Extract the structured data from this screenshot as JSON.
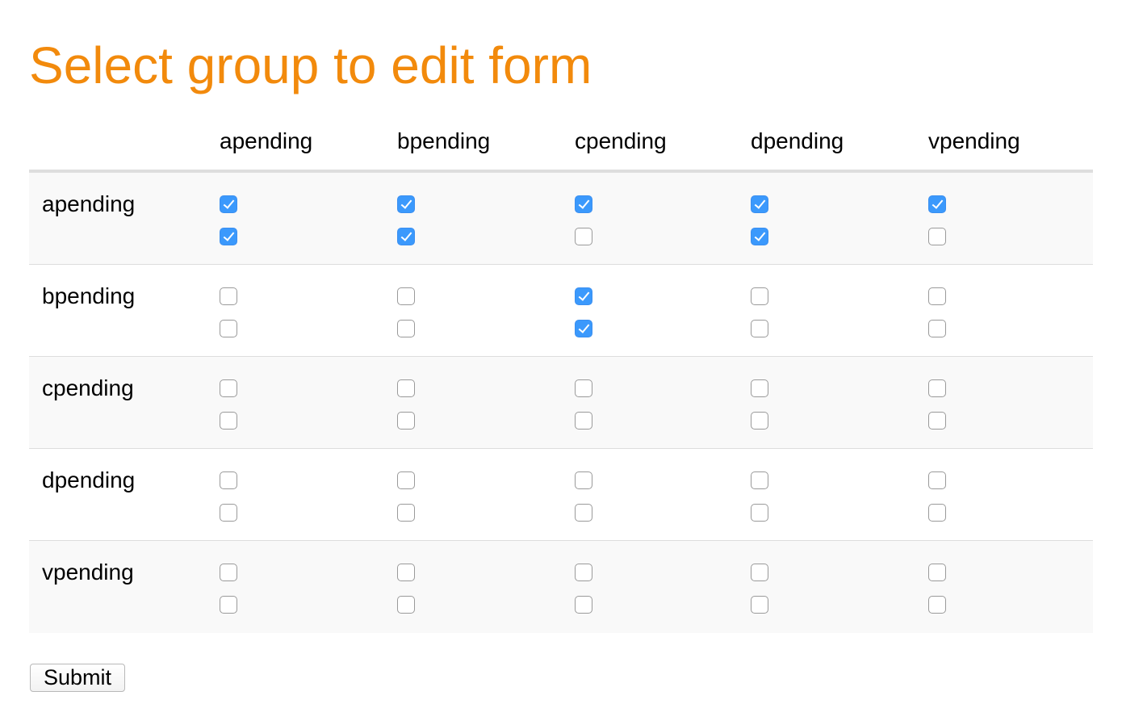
{
  "page": {
    "title": "Select group to edit form",
    "title_color": "#f28a0c",
    "accent_color": "#3b99fc"
  },
  "columns": [
    "apending",
    "bpending",
    "cpending",
    "dpending",
    "vpending"
  ],
  "rows": [
    {
      "label": "apending",
      "checks": [
        [
          true,
          true
        ],
        [
          true,
          true
        ],
        [
          true,
          false
        ],
        [
          true,
          true
        ],
        [
          true,
          false
        ]
      ]
    },
    {
      "label": "bpending",
      "checks": [
        [
          false,
          false
        ],
        [
          false,
          false
        ],
        [
          true,
          true
        ],
        [
          false,
          false
        ],
        [
          false,
          false
        ]
      ]
    },
    {
      "label": "cpending",
      "checks": [
        [
          false,
          false
        ],
        [
          false,
          false
        ],
        [
          false,
          false
        ],
        [
          false,
          false
        ],
        [
          false,
          false
        ]
      ]
    },
    {
      "label": "dpending",
      "checks": [
        [
          false,
          false
        ],
        [
          false,
          false
        ],
        [
          false,
          false
        ],
        [
          false,
          false
        ],
        [
          false,
          false
        ]
      ]
    },
    {
      "label": "vpending",
      "checks": [
        [
          false,
          false
        ],
        [
          false,
          false
        ],
        [
          false,
          false
        ],
        [
          false,
          false
        ],
        [
          false,
          false
        ]
      ]
    }
  ],
  "form": {
    "submit_label": "Submit"
  }
}
